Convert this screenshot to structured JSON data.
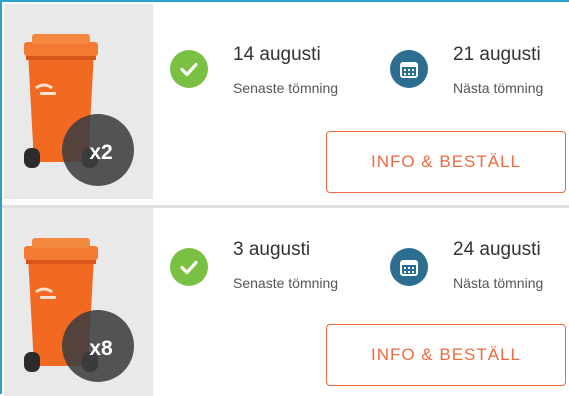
{
  "colors": {
    "accent_border": "#2aa3c9",
    "bin_orange": "#f26a21",
    "done_green": "#7ac143",
    "next_blue": "#2c6e8f",
    "button_orange": "#ec6a3f"
  },
  "bins": [
    {
      "quantity": "x2",
      "last_date": "14 augusti",
      "last_label": "Senaste tömning",
      "next_date": "21 augusti",
      "next_label": "Nästa tömning",
      "button_label": "INFO & BESTÄLL",
      "status_icon": "check-icon",
      "next_icon": "calendar-icon"
    },
    {
      "quantity": "x8",
      "last_date": "3 augusti",
      "last_label": "Senaste tömning",
      "next_date": "24 augusti",
      "next_label": "Nästa tömning",
      "button_label": "INFO & BESTÄLL",
      "status_icon": "check-icon",
      "next_icon": "calendar-icon"
    }
  ]
}
